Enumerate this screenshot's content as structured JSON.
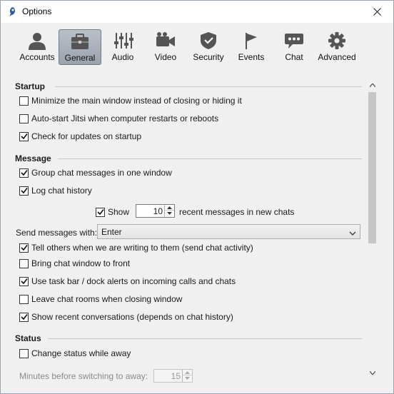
{
  "window": {
    "title": "Options",
    "app_icon": "jitsi-icon"
  },
  "tabs": [
    {
      "label": "Accounts",
      "icon": "user-icon"
    },
    {
      "label": "General",
      "icon": "briefcase-icon"
    },
    {
      "label": "Audio",
      "icon": "equalizer-icon"
    },
    {
      "label": "Video",
      "icon": "camera-icon"
    },
    {
      "label": "Security",
      "icon": "shield-icon"
    },
    {
      "label": "Events",
      "icon": "flag-icon"
    },
    {
      "label": "Chat",
      "icon": "chat-bubble-icon"
    },
    {
      "label": "Advanced",
      "icon": "gear-icon"
    }
  ],
  "active_tab": "General",
  "startup": {
    "title": "Startup",
    "options": [
      {
        "label": "Minimize the main window instead of closing or hiding it",
        "checked": false
      },
      {
        "label": "Auto-start Jitsi when computer restarts or reboots",
        "checked": false
      },
      {
        "label": "Check for updates on startup",
        "checked": true
      }
    ]
  },
  "message": {
    "title": "Message",
    "options": [
      {
        "label": "Group chat messages in one window",
        "checked": true
      },
      {
        "label": "Log chat history",
        "checked": true
      }
    ],
    "show_recent": {
      "label": "Show",
      "checked": true,
      "value": "10",
      "suffix": "recent messages in new chats"
    },
    "send_with": {
      "label": "Send messages with:",
      "value": "Enter"
    },
    "more_options": [
      {
        "label": "Tell others when we are writing to them (send chat activity)",
        "checked": true
      },
      {
        "label": "Bring chat window to front",
        "checked": false
      },
      {
        "label": "Use task bar / dock alerts on incoming calls and chats",
        "checked": true
      },
      {
        "label": "Leave chat rooms when closing window",
        "checked": false
      },
      {
        "label": "Show recent conversations (depends on chat history)",
        "checked": true
      }
    ]
  },
  "status": {
    "title": "Status",
    "options": [
      {
        "label": "Change status while away",
        "checked": false
      }
    ],
    "minutes": {
      "label": "Minutes before switching to away:",
      "value": "15"
    }
  },
  "colors": {
    "accent_active_tab": "#9aa3ac",
    "background": "#f0f0f0"
  }
}
